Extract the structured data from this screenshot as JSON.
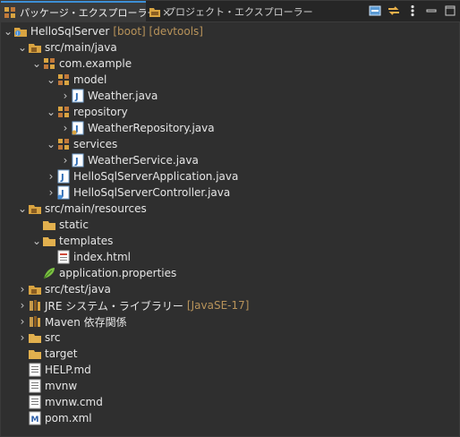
{
  "tabs": {
    "package_explorer": "パッケージ・エクスプローラー",
    "project_explorer": "プロジェクト・エクスプローラー",
    "close_symbol": "✕"
  },
  "toolbar": {
    "icons": [
      "collapse-all-icon",
      "link-with-editor-icon",
      "view-menu-icon",
      "minimize-icon",
      "maximize-icon"
    ]
  },
  "tree": [
    {
      "label": "HelloSqlServer",
      "decoration": "[boot] [devtools]",
      "icon": "project-icon",
      "expanded": true
    },
    {
      "label": "src/main/java",
      "icon": "source-folder-icon",
      "expanded": true
    },
    {
      "label": "com.example",
      "icon": "package-icon",
      "expanded": true
    },
    {
      "label": "model",
      "icon": "package-icon",
      "expanded": true
    },
    {
      "label": "Weather.java",
      "icon": "java-file-icon",
      "expanded": false
    },
    {
      "label": "repository",
      "icon": "package-icon",
      "expanded": true
    },
    {
      "label": "WeatherRepository.java",
      "icon": "java-file-icon",
      "expanded": false
    },
    {
      "label": "services",
      "icon": "package-icon",
      "expanded": true
    },
    {
      "label": "WeatherService.java",
      "icon": "java-file-icon",
      "expanded": false
    },
    {
      "label": "HelloSqlServerApplication.java",
      "icon": "java-file-icon",
      "expanded": false
    },
    {
      "label": "HelloSqlServerController.java",
      "icon": "java-file-icon",
      "expanded": false
    },
    {
      "label": "src/main/resources",
      "icon": "source-folder-icon",
      "expanded": true
    },
    {
      "label": "static",
      "icon": "folder-icon"
    },
    {
      "label": "templates",
      "icon": "folder-icon",
      "expanded": true
    },
    {
      "label": "index.html",
      "icon": "html-file-icon"
    },
    {
      "label": "application.properties",
      "icon": "properties-file-icon"
    },
    {
      "label": "src/test/java",
      "icon": "source-folder-icon",
      "expanded": false
    },
    {
      "label": "JRE システム・ライブラリー",
      "decoration": "[JavaSE-17]",
      "icon": "library-icon",
      "expanded": false
    },
    {
      "label": "Maven 依存関係",
      "icon": "library-icon",
      "expanded": false
    },
    {
      "label": "src",
      "icon": "folder-icon",
      "expanded": false
    },
    {
      "label": "target",
      "icon": "folder-icon"
    },
    {
      "label": "HELP.md",
      "icon": "text-file-icon"
    },
    {
      "label": "mvnw",
      "icon": "text-file-icon"
    },
    {
      "label": "mvnw.cmd",
      "icon": "text-file-icon"
    },
    {
      "label": "pom.xml",
      "icon": "maven-file-icon"
    }
  ]
}
